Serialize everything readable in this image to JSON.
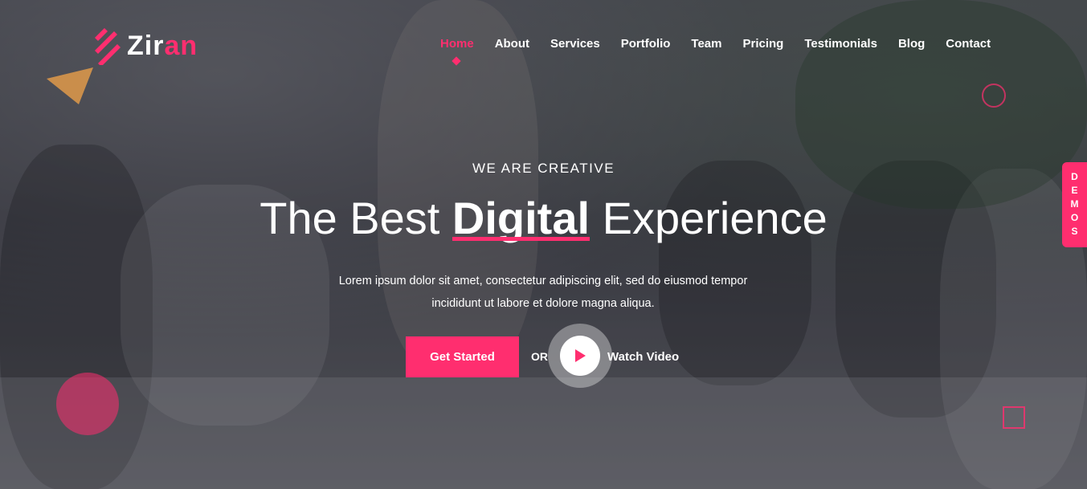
{
  "brand": {
    "name_part1": "Zir",
    "name_part2": "an",
    "accent": "#ff2e6f"
  },
  "nav": {
    "items": [
      {
        "label": "Home",
        "active": true
      },
      {
        "label": "About"
      },
      {
        "label": "Services"
      },
      {
        "label": "Portfolio"
      },
      {
        "label": "Team"
      },
      {
        "label": "Pricing"
      },
      {
        "label": "Testimonials"
      },
      {
        "label": "Blog"
      },
      {
        "label": "Contact"
      }
    ]
  },
  "hero": {
    "eyebrow": "WE ARE CREATIVE",
    "headline_pre": "The Best ",
    "headline_highlight": "Digital",
    "headline_post": " Experience",
    "description_line1": "Lorem ipsum dolor sit amet, consectetur adipiscing elit, sed do eiusmod tempor",
    "description_line2": "incididunt ut labore et dolore magna aliqua.",
    "cta_label": "Get Started",
    "or_label": "OR",
    "watch_label": "Watch Video"
  },
  "side_tab": {
    "label": "DEMOS"
  }
}
